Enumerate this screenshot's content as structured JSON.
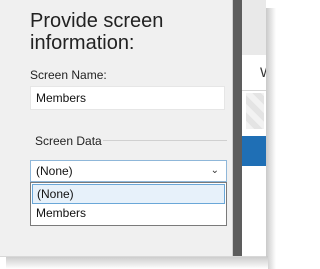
{
  "panel": {
    "title_line1": "Provide screen",
    "title_line2": "information:",
    "screen_name_label": "Screen Name:",
    "screen_name_value": "Members",
    "screen_data_label": "Screen Data",
    "screen_data_selected": "(None)",
    "dropdown_options": [
      "(None)",
      "Members"
    ]
  },
  "right_panel": {
    "clipped_text": "W"
  }
}
